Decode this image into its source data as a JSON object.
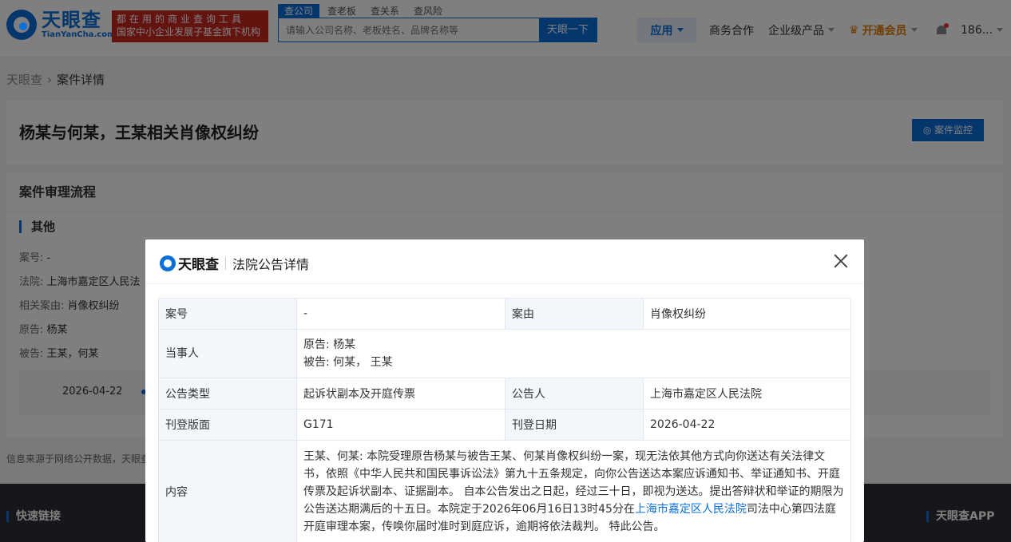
{
  "header": {
    "logo_cn": "天眼查",
    "logo_en": "TianYanCha.com",
    "slogan_line1": "都在用的商业查询工具",
    "slogan_line2": "国家中小企业发展子基金旗下机构",
    "search_tabs": [
      "查公司",
      "查老板",
      "查关系",
      "查风险"
    ],
    "search_placeholder": "请输入公司名称、老板姓名、品牌名称等",
    "search_button": "天眼一下",
    "nav_app": "应用",
    "nav_business": "商务合作",
    "nav_enterprise": "企业级产品",
    "nav_vip": "开通会员",
    "nav_user": "186..."
  },
  "breadcrumb": {
    "home": "天眼查",
    "current": "案件详情"
  },
  "case": {
    "title": "杨某与何某，王某相关肖像权纠纷",
    "monitor_button": "案件监控"
  },
  "flow": {
    "heading": "案件审理流程",
    "subheading": "其他",
    "case_no_label": "案号:",
    "case_no_value": "-",
    "court_label": "法院:",
    "court_value": "上海市嘉定区人民法",
    "cause_label": "相关案由:",
    "cause_value": "肖像权纠纷",
    "plaintiff_label": "原告:",
    "plaintiff_value": "杨某",
    "defendant_label": "被告:",
    "defendant_value": "王某，何某",
    "timeline_date": "2026-04-22"
  },
  "source_note": "信息来源于网络公开数据，天眼查",
  "footer": {
    "quick_links": "快速链接",
    "app": "天眼查APP"
  },
  "modal": {
    "logo_text": "天眼查",
    "title": "法院公告详情",
    "rows": {
      "case_no_key": "案号",
      "case_no_value": "-",
      "cause_key": "案由",
      "cause_value": "肖像权纠纷",
      "parties_key": "当事人",
      "parties_plaintiff": "原告: 杨某",
      "parties_defendant": "被告: 何某， 王某",
      "type_key": "公告类型",
      "type_value": "起诉状副本及开庭传票",
      "announcer_key": "公告人",
      "announcer_value": "上海市嘉定区人民法院",
      "page_key": "刊登版面",
      "page_value": "G171",
      "date_key": "刊登日期",
      "date_value": "2026-04-22",
      "content_key": "内容",
      "content_part1": "王某、何某: 本院受理原告杨某与被告王某、何某肖像权纠纷一案，现无法依其他方式向你送达有关法律文书，依照《中华人民共和国民事诉讼法》第九十五条规定，向你公告送达本案应诉通知书、举证通知书、开庭传票及起诉状副本、证据副本。 自本公告发出之日起，经过三十日，即视为送达。提出答辩状和举证的期限为公告送达期满后的十五日。本院定于2026年06月16日13时45分在",
      "content_link": "上海市嘉定区人民法院",
      "content_part2": "司法中心第四法庭开庭审理本案，传唤你届时准时到庭应诉，逾期将依法裁判。 特此公告。"
    }
  }
}
